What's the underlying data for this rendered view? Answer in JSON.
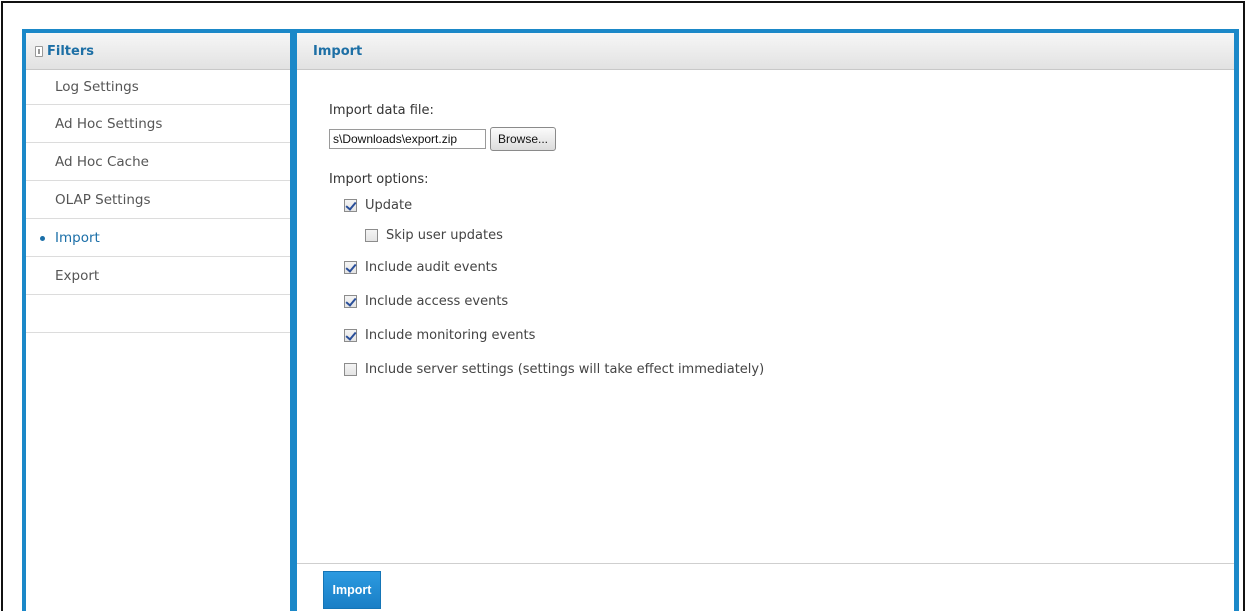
{
  "sidebar": {
    "title": "Filters",
    "items": [
      {
        "label": "Log Settings"
      },
      {
        "label": "Ad Hoc Settings"
      },
      {
        "label": "Ad Hoc Cache"
      },
      {
        "label": "OLAP Settings"
      },
      {
        "label": "Import",
        "active": true
      },
      {
        "label": "Export"
      }
    ]
  },
  "main": {
    "title": "Import",
    "file_label": "Import data file:",
    "file_value": "s\\Downloads\\export.zip",
    "browse_label": "Browse...",
    "options_label": "Import options:",
    "options": [
      {
        "label": "Update",
        "checked": true
      },
      {
        "label": "Skip user updates",
        "checked": false
      },
      {
        "label": "Include audit events",
        "checked": true
      },
      {
        "label": "Include access events",
        "checked": true
      },
      {
        "label": "Include monitoring events",
        "checked": true
      },
      {
        "label": "Include server settings (settings will take effect immediately)",
        "checked": false
      }
    ],
    "import_button": "Import"
  },
  "colors": {
    "accent": "#1b88c8",
    "title_text": "#1d6fa5"
  }
}
